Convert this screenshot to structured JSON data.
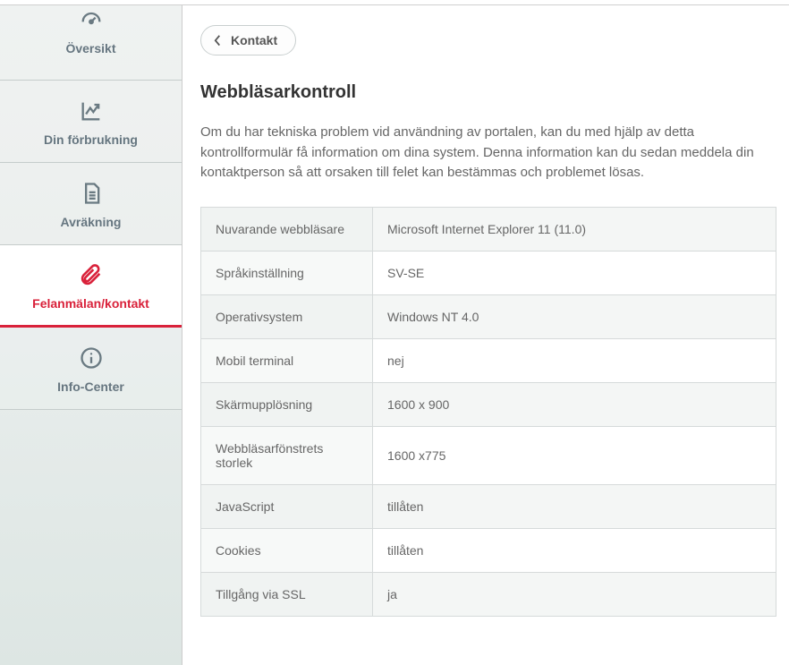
{
  "sidebar": {
    "items": [
      {
        "label": "Översikt",
        "icon": "gauge-icon"
      },
      {
        "label": "Din förbrukning",
        "icon": "chart-icon"
      },
      {
        "label": "Avräkning",
        "icon": "document-icon"
      },
      {
        "label": "Felanmälan/kontakt",
        "icon": "paperclip-icon",
        "active": true
      },
      {
        "label": "Info-Center",
        "icon": "info-icon"
      }
    ]
  },
  "main": {
    "back_label": "Kontakt",
    "title": "Webbläsarkontroll",
    "description": "Om du har tekniska problem vid användning av portalen, kan du med hjälp av detta kontrollformulär få information om dina system. Denna information kan du sedan meddela din kontaktperson så att orsaken till felet kan bestämmas och problemet lösas.",
    "rows": [
      {
        "key": "Nuvarande webbläsare",
        "value": "Microsoft Internet Explorer 11 (11.0)"
      },
      {
        "key": "Språkinställning",
        "value": "SV-SE"
      },
      {
        "key": "Operativsystem",
        "value": "Windows NT 4.0"
      },
      {
        "key": "Mobil terminal",
        "value": "nej"
      },
      {
        "key": "Skärmupplösning",
        "value": "1600 x 900"
      },
      {
        "key": "Webbläsarfönstrets storlek",
        "value": "1600 x775"
      },
      {
        "key": "JavaScript",
        "value": "tillåten"
      },
      {
        "key": "Cookies",
        "value": "tillåten"
      },
      {
        "key": "Tillgång via SSL",
        "value": "ja"
      }
    ]
  }
}
